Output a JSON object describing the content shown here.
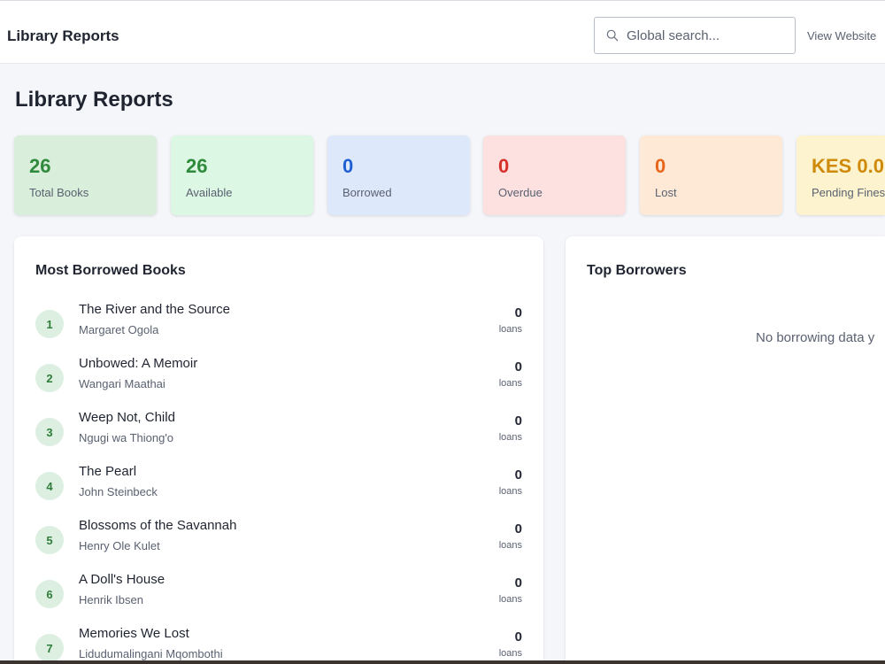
{
  "header": {
    "title": "Library Reports",
    "search_placeholder": "Global search...",
    "view_website": "View Website"
  },
  "page": {
    "title": "Library Reports"
  },
  "stats": [
    {
      "value": "26",
      "label": "Total Books",
      "bg": "#d9eedb",
      "color": "#2f8a3b"
    },
    {
      "value": "26",
      "label": "Available",
      "bg": "#dcf7e4",
      "color": "#2f8a3b"
    },
    {
      "value": "0",
      "label": "Borrowed",
      "bg": "#dde9fb",
      "color": "#1f5fd1"
    },
    {
      "value": "0",
      "label": "Overdue",
      "bg": "#fde1e1",
      "color": "#d6312b"
    },
    {
      "value": "0",
      "label": "Lost",
      "bg": "#fde9d6",
      "color": "#e8661c"
    },
    {
      "value": "KES 0.0",
      "label": "Pending Fines",
      "bg": "#fdf4cf",
      "color": "#cf8a0a"
    }
  ],
  "most_borrowed": {
    "title": "Most Borrowed Books",
    "loans_label": "loans",
    "books": [
      {
        "rank": "1",
        "title": "The River and the Source",
        "author": "Margaret Ogola",
        "loans": "0"
      },
      {
        "rank": "2",
        "title": "Unbowed: A Memoir",
        "author": "Wangari Maathai",
        "loans": "0"
      },
      {
        "rank": "3",
        "title": "Weep Not, Child",
        "author": "Ngugi wa Thiong'o",
        "loans": "0"
      },
      {
        "rank": "4",
        "title": "The Pearl",
        "author": "John Steinbeck",
        "loans": "0"
      },
      {
        "rank": "5",
        "title": "Blossoms of the Savannah",
        "author": "Henry Ole Kulet",
        "loans": "0"
      },
      {
        "rank": "6",
        "title": "A Doll's House",
        "author": "Henrik Ibsen",
        "loans": "0"
      },
      {
        "rank": "7",
        "title": "Memories We Lost",
        "author": "Lidudumalingani Mqombothi",
        "loans": "0"
      }
    ]
  },
  "top_borrowers": {
    "title": "Top Borrowers",
    "empty_message": "No borrowing data y"
  }
}
